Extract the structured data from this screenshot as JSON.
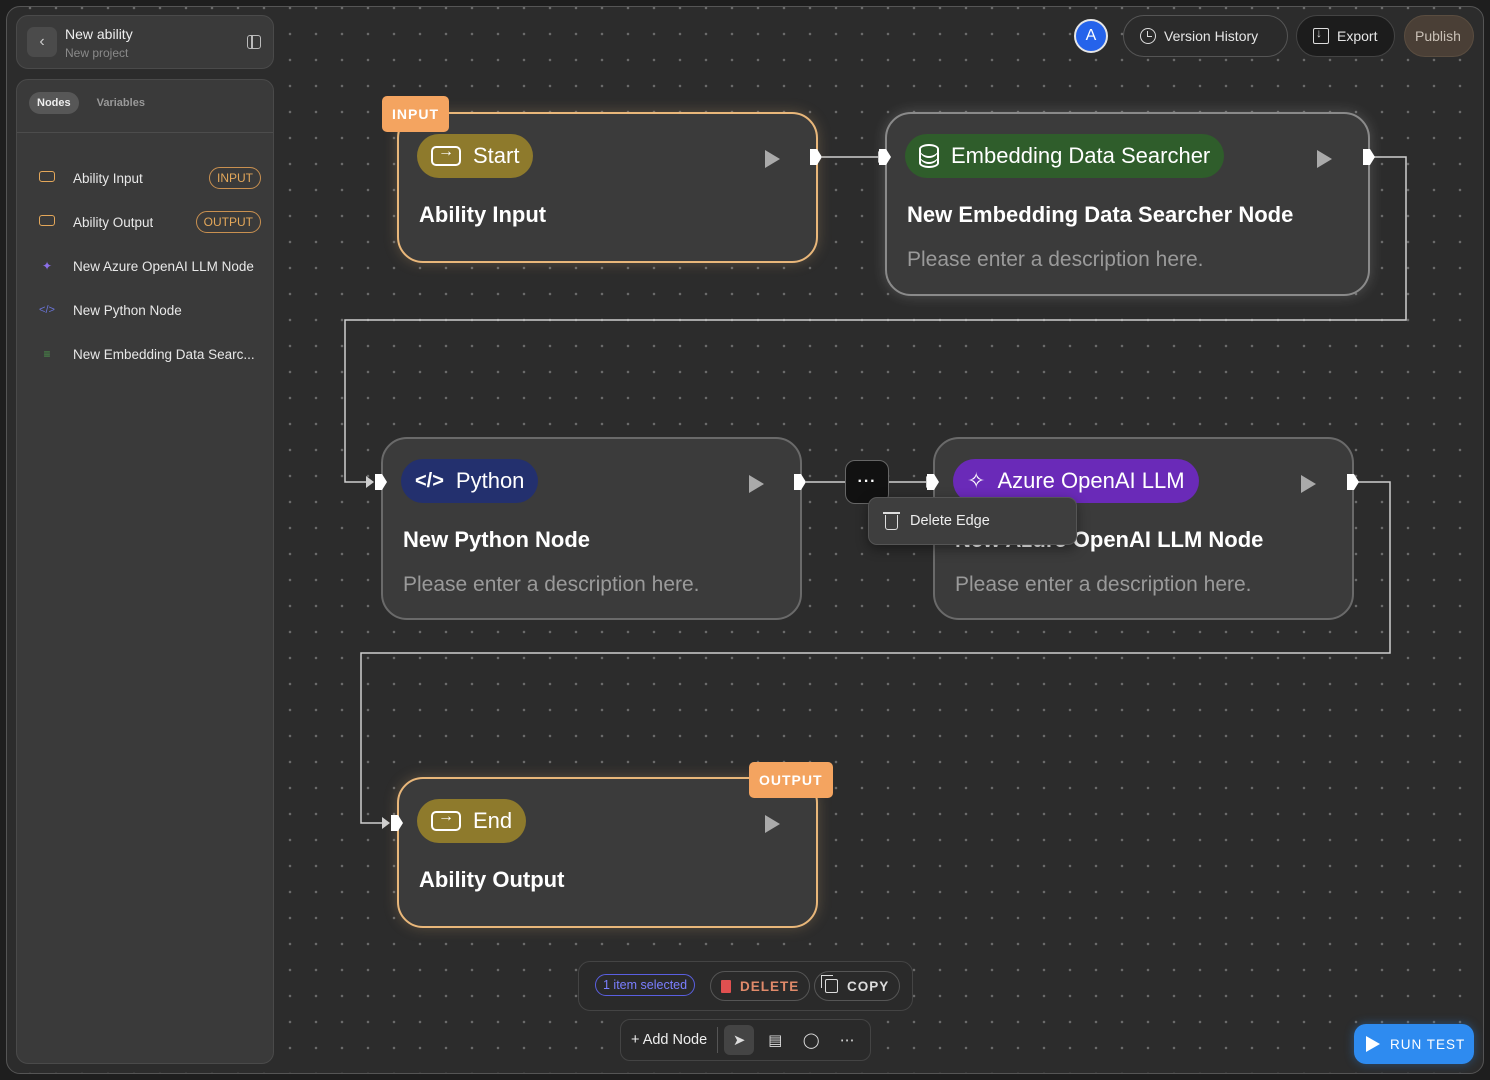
{
  "project": {
    "title": "New ability",
    "subtitle": "New project"
  },
  "sidebar": {
    "tabs": [
      {
        "label": "Nodes",
        "active": true
      },
      {
        "label": "Variables",
        "active": false
      }
    ],
    "items": [
      {
        "label": "Ability Input",
        "icon": "io-icon",
        "badge": "INPUT"
      },
      {
        "label": "Ability Output",
        "icon": "io-icon",
        "badge": "OUTPUT"
      },
      {
        "label": "New Azure OpenAI LLM Node",
        "icon": "sparkles-icon",
        "badge": ""
      },
      {
        "label": "New Python Node",
        "icon": "code-icon",
        "badge": ""
      },
      {
        "label": "New Embedding Data Searc...",
        "icon": "database-icon",
        "badge": ""
      }
    ]
  },
  "header": {
    "avatar": "A",
    "version_history": "Version History",
    "export": "Export",
    "publish": "Publish"
  },
  "nodes": {
    "start": {
      "tag": "INPUT",
      "pill": "Start",
      "title": "Ability Input"
    },
    "embedding": {
      "pill": "Embedding Data Searcher",
      "title": "New Embedding Data Searcher Node",
      "desc": "Please enter a description here."
    },
    "python": {
      "pill": "Python",
      "title": "New Python Node",
      "desc": "Please enter a description here."
    },
    "azure": {
      "pill": "Azure OpenAI LLM",
      "title": "New Azure OpenAI LLM Node",
      "desc": "Please enter a description here."
    },
    "end": {
      "tag": "OUTPUT",
      "pill": "End",
      "title": "Ability Output"
    }
  },
  "edge_menu": {
    "button": "···",
    "delete_label": "Delete Edge"
  },
  "selection_bar": {
    "count": "1 item selected",
    "delete": "DELETE",
    "copy": "COPY"
  },
  "toolbar": {
    "add_node": "+ Add Node"
  },
  "run_test": "RUN TEST",
  "colors": {
    "io_border": "#e9b77a",
    "tag_bg": "#f4a460",
    "python_pill": "#23306e",
    "azure_pill": "#6a2ab8",
    "embedding_pill": "#2f5d2b",
    "run_test": "#2e8bf0"
  }
}
